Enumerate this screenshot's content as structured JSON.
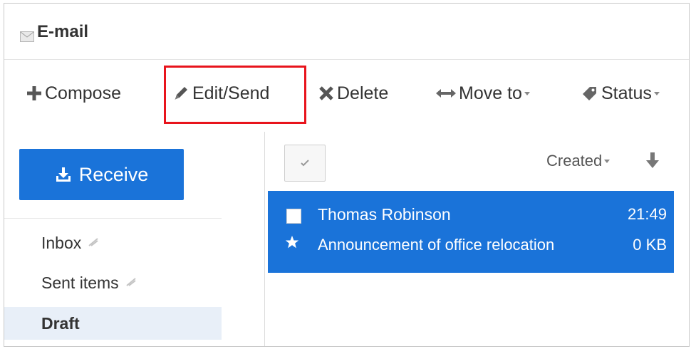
{
  "app": {
    "title": "E-mail"
  },
  "toolbar": {
    "compose": "Compose",
    "edit_send": "Edit/Send",
    "delete": "Delete",
    "move_to": "Move to",
    "status": "Status"
  },
  "sidebar": {
    "receive": "Receive",
    "folders": [
      {
        "label": "Inbox"
      },
      {
        "label": "Sent items"
      },
      {
        "label": "Draft"
      }
    ]
  },
  "list": {
    "sort_label": "Created",
    "messages": [
      {
        "from": "Thomas Robinson",
        "time": "21:49",
        "subject": "Announcement of office relocation",
        "size": "0 KB"
      }
    ]
  },
  "colors": {
    "accent": "#1a73d9",
    "highlight": "#e8141c",
    "active_folder": "#e8eff8"
  },
  "icons": {
    "compose": "plus-icon",
    "edit": "pencil-icon",
    "delete": "x-icon",
    "move": "double-arrow-icon",
    "status": "tag-icon",
    "receive": "download-icon",
    "pin": "pin-icon",
    "sort": "arrow-down-icon",
    "star": "star-icon",
    "check": "check-icon"
  }
}
